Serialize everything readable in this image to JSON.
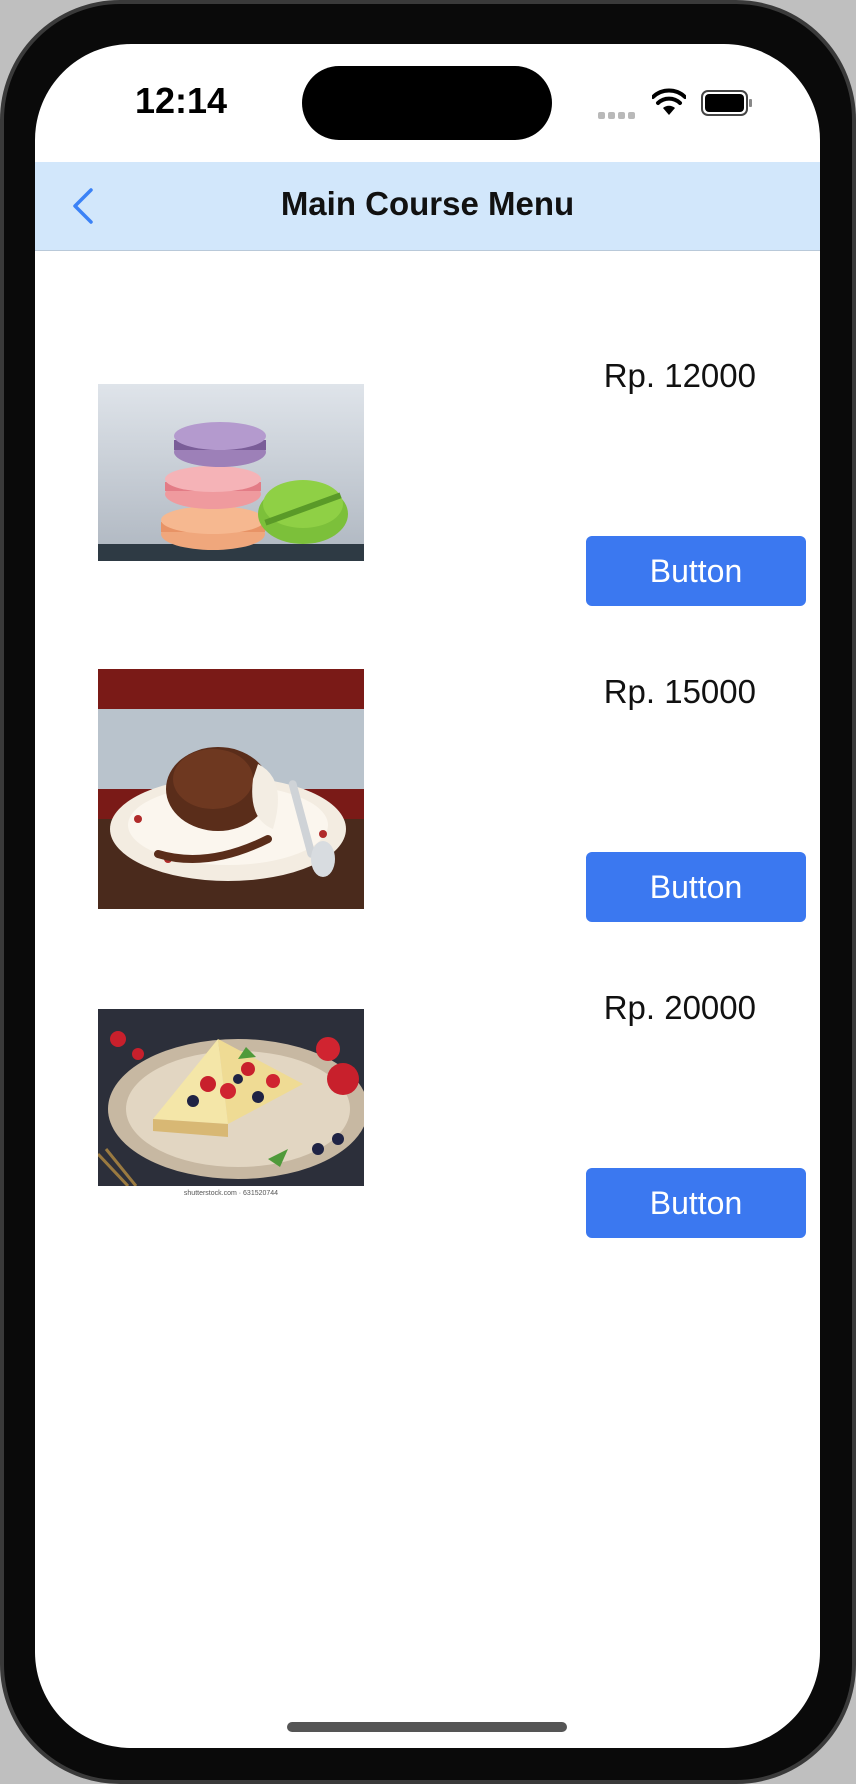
{
  "status_bar": {
    "time": "12:14"
  },
  "nav": {
    "title": "Main Course Menu",
    "back_icon": "chevron-left-icon",
    "accent": "#3b82f6",
    "background": "#d2e7fb"
  },
  "menu": {
    "items": [
      {
        "image": "macarons-photo",
        "price": "Rp. 12000",
        "button_label": "Button"
      },
      {
        "image": "chocolate-lava-cake-photo",
        "price": "Rp. 15000",
        "button_label": "Button"
      },
      {
        "image": "berry-cheesecake-photo",
        "price": "Rp. 20000",
        "button_label": "Button",
        "image_caption": "shutterstock.com · 631520744"
      }
    ]
  },
  "colors": {
    "button": "#3b78f0",
    "button_text": "#ffffff"
  }
}
